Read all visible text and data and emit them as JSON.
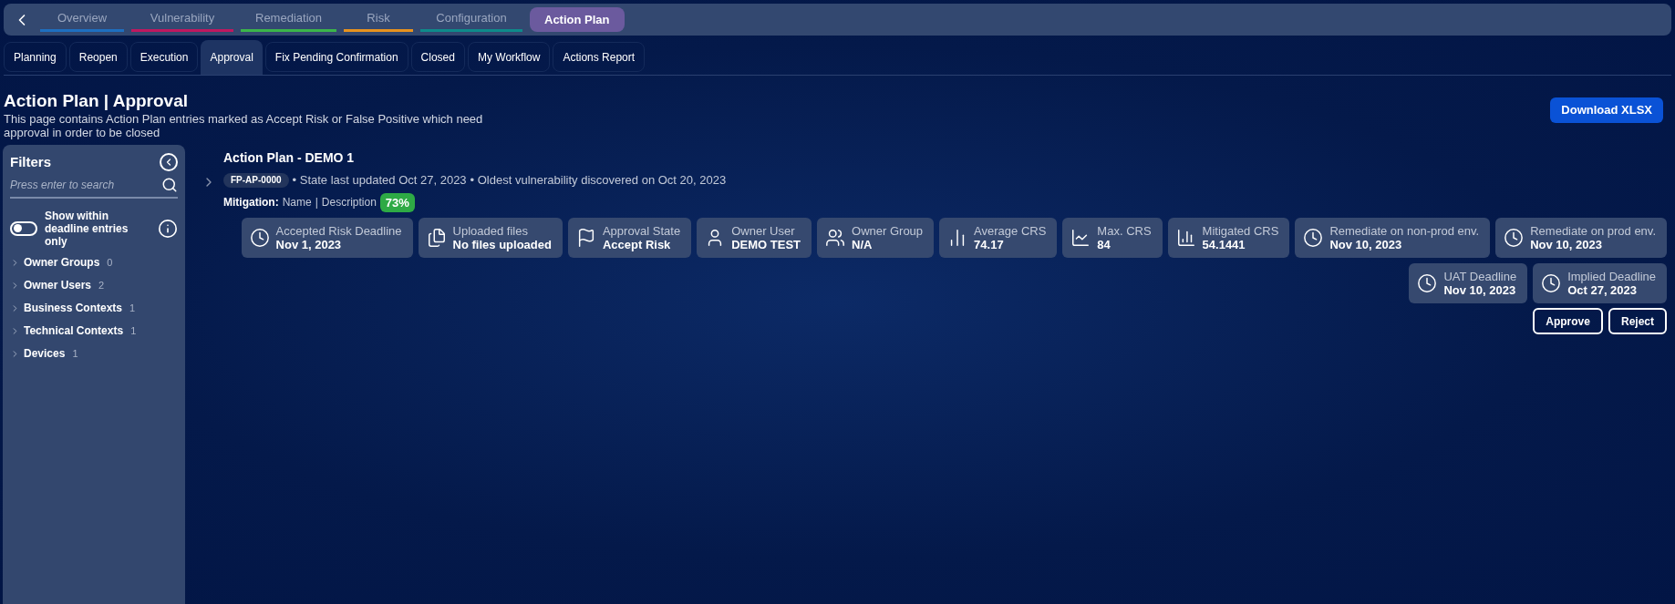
{
  "top_nav": {
    "tabs": [
      {
        "label": "Overview",
        "color": "#1e6fc0",
        "selected": false
      },
      {
        "label": "Vulnerability",
        "color": "#c0185f",
        "selected": false
      },
      {
        "label": "Remediation",
        "color": "#3bb54a",
        "selected": false
      },
      {
        "label": "Risk",
        "color": "#e8921e",
        "selected": false
      },
      {
        "label": "Configuration",
        "color": "#0e8a8a",
        "selected": false
      },
      {
        "label": "Action Plan",
        "color": "#6b5a9e",
        "selected": true
      }
    ]
  },
  "sub_tabs": [
    {
      "label": "Planning",
      "selected": false
    },
    {
      "label": "Reopen",
      "selected": false
    },
    {
      "label": "Execution",
      "selected": false
    },
    {
      "label": "Approval",
      "selected": true
    },
    {
      "label": "Fix Pending Confirmation",
      "selected": false
    },
    {
      "label": "Closed",
      "selected": false
    },
    {
      "label": "My Workflow",
      "selected": false
    },
    {
      "label": "Actions Report",
      "selected": false
    }
  ],
  "page": {
    "title": "Action Plan | Approval",
    "description": "This page contains Action Plan entries marked as Accept Risk or False Positive which need approval in order to be closed",
    "download_button": "Download XLSX"
  },
  "filters": {
    "title": "Filters",
    "search_placeholder": "Press enter to search",
    "toggle": {
      "label": "Show within deadline entries only",
      "on": false
    },
    "groups": [
      {
        "label": "Owner Groups",
        "count": "0",
        "expanded": false
      },
      {
        "label": "Owner Users",
        "count": "2",
        "expanded": false
      },
      {
        "label": "Business Contexts",
        "count": "1",
        "expanded": false
      },
      {
        "label": "Technical Contexts",
        "count": "1",
        "expanded": false
      },
      {
        "label": "Devices",
        "count": "1",
        "expanded": false
      }
    ]
  },
  "entry": {
    "title": "Action Plan - DEMO 1",
    "expanded": false,
    "id": "FP-AP-0000",
    "state_updated": "• State last updated Oct 27, 2023",
    "oldest": "• Oldest vulnerability discovered on Oct 20, 2023",
    "mitigation_label": "Mitigation:",
    "mitigation_name": "Name",
    "mitigation_separator": "|",
    "mitigation_description": "Description",
    "mitigation_percent": "73%",
    "cards": [
      {
        "kind": "deadline",
        "label": "Accepted Risk Deadline",
        "value": "Nov 1, 2023"
      },
      {
        "kind": "files",
        "label": "Uploaded files",
        "value": "No files uploaded"
      },
      {
        "kind": "state",
        "label": "Approval State",
        "value": "Accept Risk"
      },
      {
        "kind": "user",
        "label": "Owner User",
        "value": "DEMO TEST"
      },
      {
        "kind": "group",
        "label": "Owner Group",
        "value": "N/A"
      },
      {
        "kind": "average",
        "label": "Average CRS",
        "value": "74.17"
      },
      {
        "kind": "max",
        "label": "Max. CRS",
        "value": "84"
      },
      {
        "kind": "mitigated",
        "label": "Mitigated CRS",
        "value": "54.1441"
      },
      {
        "kind": "deadline",
        "label": "Remediate on non-prod env.",
        "value": "Nov 10, 2023"
      },
      {
        "kind": "deadline",
        "label": "Remediate on prod env.",
        "value": "Nov 10, 2023"
      },
      {
        "kind": "deadline",
        "label": "UAT Deadline",
        "value": "Nov 10, 2023"
      },
      {
        "kind": "deadline",
        "label": "Implied Deadline",
        "value": "Oct 27, 2023"
      }
    ],
    "actions": [
      "Approve",
      "Reject"
    ]
  }
}
